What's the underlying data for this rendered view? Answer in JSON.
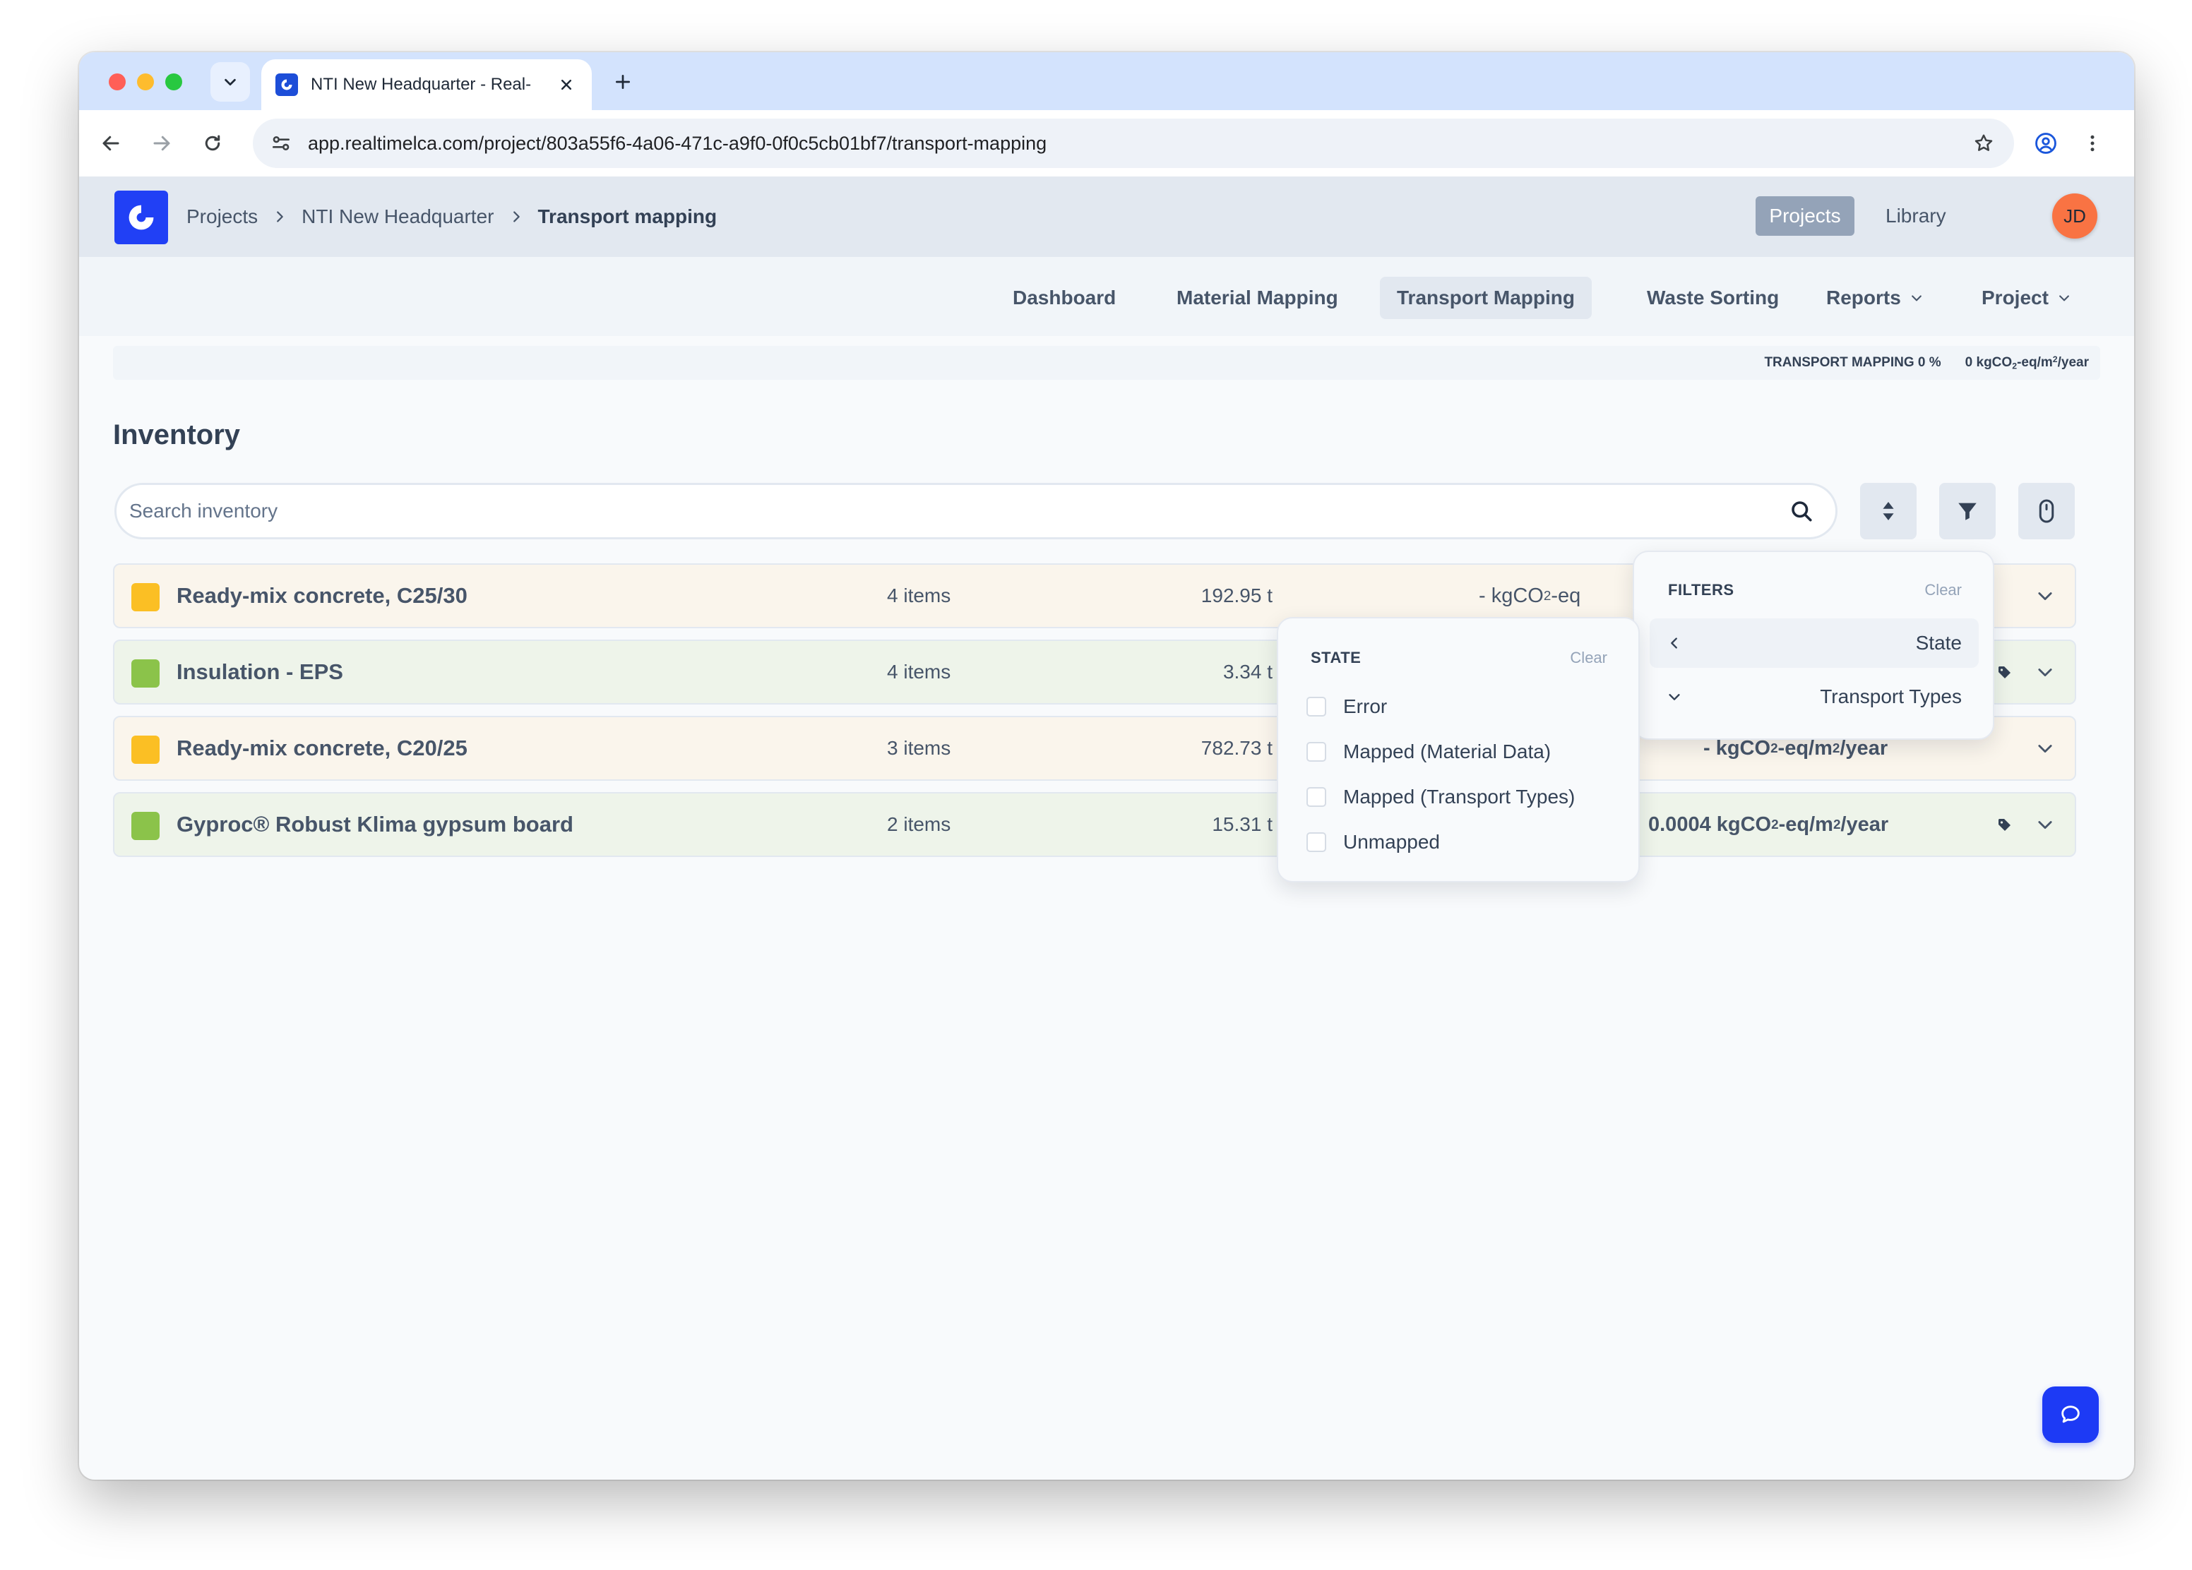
{
  "browser": {
    "tab_title": "NTI New Headquarter - Real-",
    "url": "app.realtimelca.com/project/803a55f6-4a06-471c-a9f0-0f0c5cb01bf7/transport-mapping"
  },
  "header": {
    "breadcrumb": [
      "Projects",
      "NTI New Headquarter",
      "Transport mapping"
    ],
    "projects_label": "Projects",
    "library_label": "Library",
    "avatar_initials": "JD"
  },
  "subnav": {
    "items": [
      {
        "label": "Dashboard"
      },
      {
        "label": "Material Mapping"
      },
      {
        "label": "Transport Mapping",
        "active": true
      },
      {
        "label": "Waste Sorting"
      },
      {
        "label": "Reports"
      },
      {
        "label": "Project"
      }
    ]
  },
  "progress": {
    "label": "TRANSPORT MAPPING 0 %",
    "emission_value": "0 kgCO",
    "emission_sub": "2",
    "emission_mid": "-eq/m",
    "emission_sup": "2",
    "emission_tail": "/year"
  },
  "inventory": {
    "title": "Inventory",
    "search_placeholder": "Search inventory",
    "rows": [
      {
        "name": "Ready-mix concrete, C25/30",
        "items": "4 items",
        "mass": "192.95 t",
        "co2_pre": "- kgCO",
        "co2_sub": "2",
        "co2_post": "-eq",
        "color": "#fbbf24"
      },
      {
        "name": "Insulation - EPS",
        "items": "4 items",
        "mass": "3.34 t",
        "color": "#8bc34a"
      },
      {
        "name": "Ready-mix concrete, C20/25",
        "items": "3 items",
        "mass": "782.73 t",
        "co2_pre": "- kgCO",
        "co2_sub": "2",
        "co2_mid": "-eq/m",
        "co2_sup": "2",
        "co2_post": "/year",
        "color": "#fbbf24"
      },
      {
        "name": "Gyproc® Robust Klima gypsum board",
        "items": "2 items",
        "mass": "15.31 t",
        "co2_pre": "0.0004 kgCO",
        "co2_sub": "2",
        "co2_mid": "-eq/m",
        "co2_sup": "2",
        "co2_post": "/year",
        "color": "#8bc34a"
      }
    ]
  },
  "filters": {
    "title": "FILTERS",
    "clear_label": "Clear",
    "items": [
      {
        "label": "State",
        "active": true
      },
      {
        "label": "Transport Types"
      }
    ]
  },
  "state_filter": {
    "title": "STATE",
    "clear_label": "Clear",
    "options": [
      "Error",
      "Mapped (Material Data)",
      "Mapped (Transport Types)",
      "Unmapped"
    ]
  },
  "colors": {
    "brand": "#2140f5",
    "orange_swatch": "#fbbf24",
    "green_swatch": "#8bc34a",
    "avatar": "#f97343"
  }
}
